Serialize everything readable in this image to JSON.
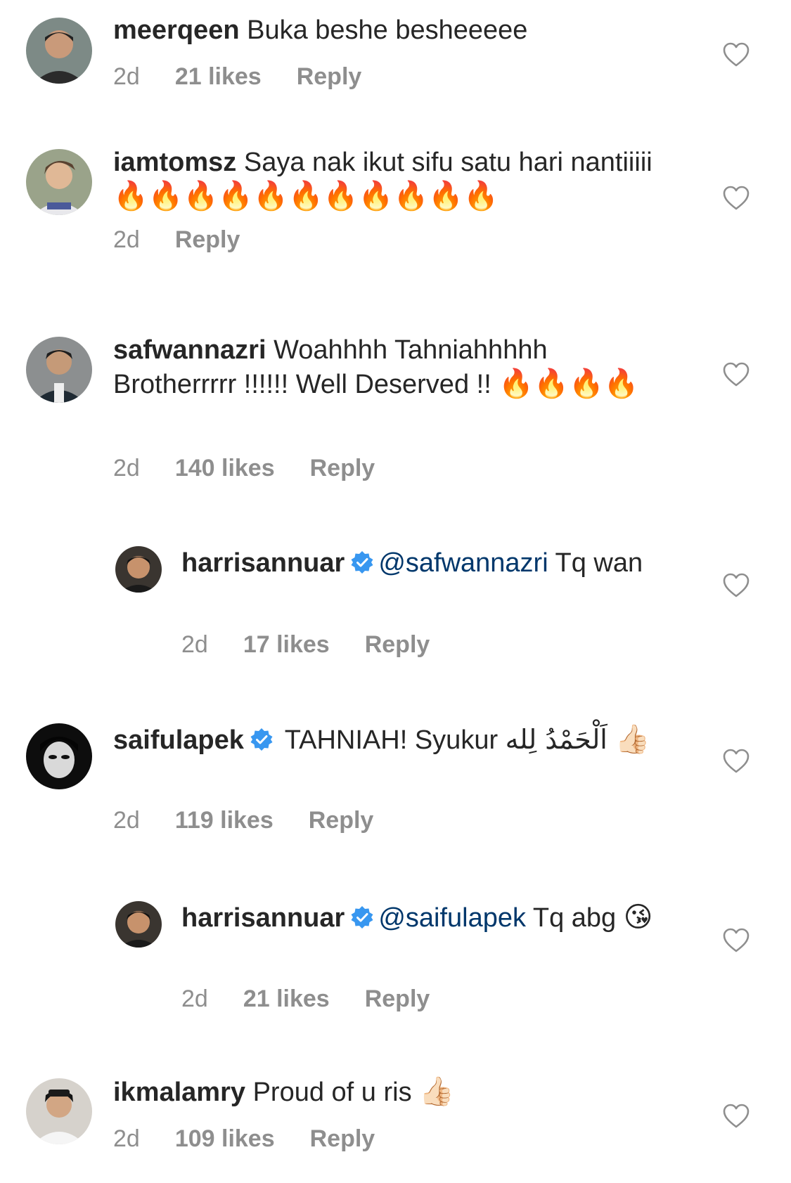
{
  "comments": [
    {
      "username": "meerqeen",
      "text": "Buka beshe besheeeee",
      "time": "2d",
      "likes": "21 likes",
      "reply": "Reply"
    },
    {
      "username": "iamtomsz",
      "text": "Saya nak ikut sifu satu hari nantiiiii",
      "emoji": "🔥🔥🔥🔥🔥🔥🔥🔥🔥🔥🔥",
      "time": "2d",
      "reply": "Reply"
    },
    {
      "username": "safwannazri",
      "text": "Woahhhh Tahniahhhhh Brotherrrrr !!!!!! Well Deserved !!",
      "emoji": "🔥🔥🔥🔥",
      "time": "2d",
      "likes": "140 likes",
      "reply": "Reply"
    },
    {
      "username": "harrisannuar",
      "verified": true,
      "mention": "@safwannazri",
      "text": "Tq wan",
      "time": "2d",
      "likes": "17 likes",
      "reply": "Reply"
    },
    {
      "username": "saifulapek",
      "verified": true,
      "text": "TAHNIAH! Syukur",
      "arabic": "اَلْحَمْدُ لِله",
      "emoji": "👍🏻",
      "time": "2d",
      "likes": "119 likes",
      "reply": "Reply"
    },
    {
      "username": "harrisannuar",
      "verified": true,
      "mention": "@saifulapek",
      "text": "Tq abg",
      "emoji": "😘",
      "time": "2d",
      "likes": "21 likes",
      "reply": "Reply"
    },
    {
      "username": "ikmalamry",
      "text": "Proud of u ris",
      "emoji": "👍🏻",
      "time": "2d",
      "likes": "109 likes",
      "reply": "Reply"
    }
  ],
  "icons": {
    "like": "heart-outline-icon",
    "verified": "verified-badge-icon"
  },
  "colors": {
    "text": "#262626",
    "meta": "#8e8e8e",
    "mention": "#00376b",
    "verified": "#3897f0"
  }
}
